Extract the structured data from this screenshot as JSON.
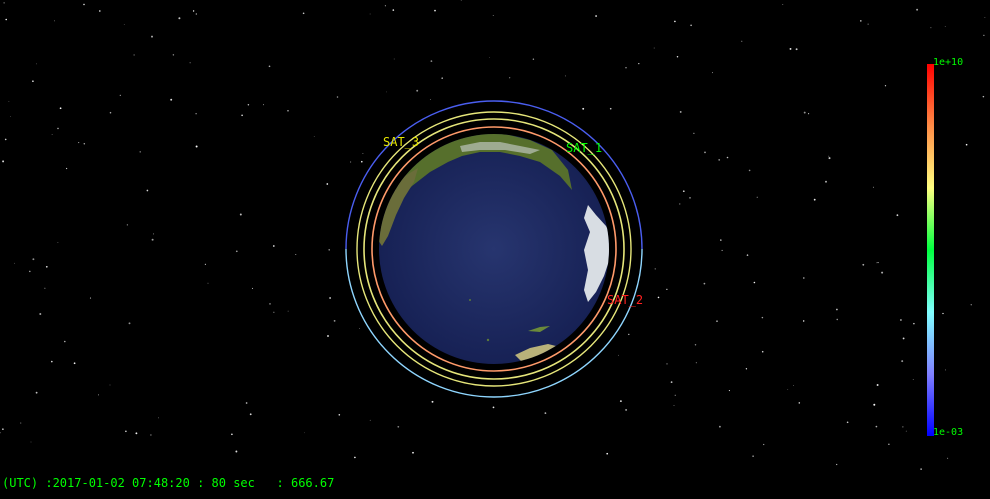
{
  "view": {
    "background": "#000000",
    "globe_view": "Pacific Ocean hemisphere",
    "ocean_color": "#1c2a66",
    "land_color": "#4d6b2a"
  },
  "satellites": [
    {
      "label": "SAT_1",
      "color": "#00ff00"
    },
    {
      "label": "SAT_2",
      "color": "#ff2020"
    },
    {
      "label": "SAT_3",
      "color": "#e6e600"
    }
  ],
  "colorbar": {
    "max_label": "1e+10",
    "min_label": "1e-03",
    "colors": [
      "#ff0000",
      "#ff8c46",
      "#ffff80",
      "#00ff40",
      "#80ffff",
      "#8080ff",
      "#0000ff"
    ]
  },
  "status": {
    "text": "(UTC) :2017-01-02 07:48:20 : 80 sec   : 666.67",
    "color": "#00ff00"
  }
}
